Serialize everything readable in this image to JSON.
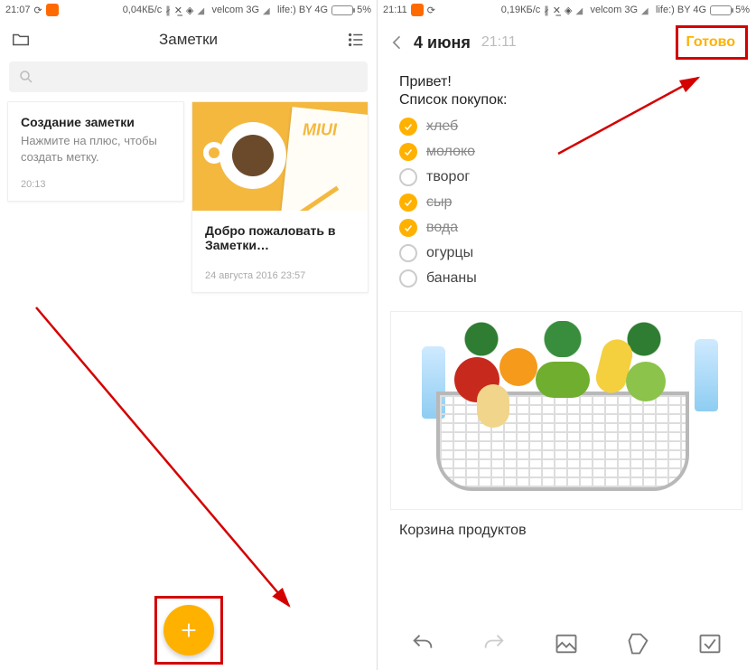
{
  "left": {
    "status": {
      "time": "21:07",
      "net_speed": "0,04КБ/с",
      "carrier1": "velcom 3G",
      "carrier2": "life:) BY 4G",
      "battery_pct": "5%"
    },
    "header": {
      "title": "Заметки"
    },
    "search": {
      "placeholder": ""
    },
    "cards": [
      {
        "title": "Создание заметки",
        "subtitle": "Нажмите на плюс, чтобы создать метку.",
        "time": "20:13"
      },
      {
        "miui": "MIUI",
        "title": "Добро пожаловать в Заметки…",
        "time": "24 августа 2016 23:57"
      }
    ]
  },
  "right": {
    "status": {
      "time": "21:11",
      "net_speed": "0,19КБ/с",
      "carrier1": "velcom 3G",
      "carrier2": "life:) BY 4G",
      "battery_pct": "5%"
    },
    "header": {
      "date": "4 июня",
      "time": "21:11",
      "done": "Готово"
    },
    "note": {
      "greeting": "Привет!",
      "list_title": "Список покупок:",
      "items": [
        {
          "label": "хлеб",
          "done": true
        },
        {
          "label": "молоко",
          "done": true
        },
        {
          "label": "творог",
          "done": false
        },
        {
          "label": "сыр",
          "done": true
        },
        {
          "label": "вода",
          "done": true
        },
        {
          "label": "огурцы",
          "done": false
        },
        {
          "label": "бананы",
          "done": false
        }
      ],
      "caption": "Корзина продуктов"
    },
    "toolbar": {
      "undo": "undo",
      "redo": "redo",
      "image": "image",
      "tag": "tag",
      "check": "check"
    }
  },
  "colors": {
    "accent": "#ffb100",
    "highlight": "#d40000"
  }
}
